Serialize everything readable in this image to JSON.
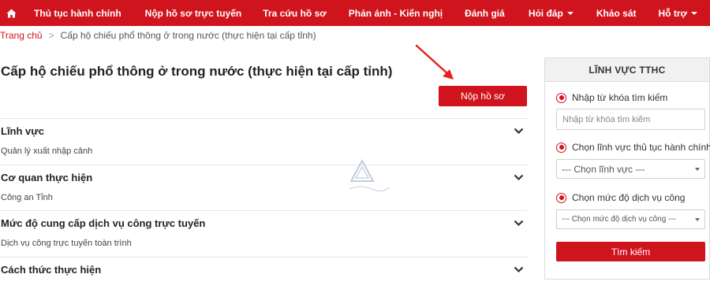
{
  "nav": {
    "items": [
      {
        "label": "Thủ tục hành chính",
        "dropdown": false
      },
      {
        "label": "Nộp hồ sơ trực tuyến",
        "dropdown": false
      },
      {
        "label": "Tra cứu hồ sơ",
        "dropdown": false
      },
      {
        "label": "Phản ánh - Kiến nghị",
        "dropdown": false
      },
      {
        "label": "Đánh giá",
        "dropdown": false
      },
      {
        "label": "Hỏi đáp",
        "dropdown": true
      },
      {
        "label": "Khảo sát",
        "dropdown": false
      },
      {
        "label": "Hỗ trợ",
        "dropdown": true
      }
    ]
  },
  "breadcrumb": {
    "home": "Trang chủ",
    "separator": ">",
    "current": "Cấp hộ chiếu phổ thông ở trong nước (thực hiện tại cấp tỉnh)"
  },
  "main": {
    "title": "Cấp hộ chiếu phổ thông ở trong nước (thực hiện tại cấp tỉnh)",
    "submit_label": "Nộp hồ sơ",
    "sections": [
      {
        "title": "Lĩnh vực",
        "value": "Quản lý xuất nhập cảnh"
      },
      {
        "title": "Cơ quan thực hiện",
        "value": "Công an Tỉnh"
      },
      {
        "title": "Mức độ cung cấp dịch vụ công trực tuyến",
        "value": "Dịch vụ công trực tuyến toàn trình"
      },
      {
        "title": "Cách thức thực hiện",
        "value": ""
      }
    ]
  },
  "panel": {
    "title": "LĨNH VỰC TTHC",
    "keyword_radio": "Nhập từ khóa tìm kiếm",
    "keyword_placeholder": "Nhập từ khóa tìm kiếm",
    "field_radio": "Chọn lĩnh vực thủ tục hành chính",
    "field_select": "--- Chọn lĩnh vực ---",
    "level_radio": "Chọn mức độ dịch vụ công",
    "level_select": "--- Chọn mức độ dịch vụ công ---",
    "search_label": "Tìm kiếm"
  },
  "colors": {
    "brand": "#d0141e",
    "annotation_arrow": "#e8201c"
  },
  "icons": {
    "home": "home-icon",
    "chevron": "chevron-down-icon"
  }
}
